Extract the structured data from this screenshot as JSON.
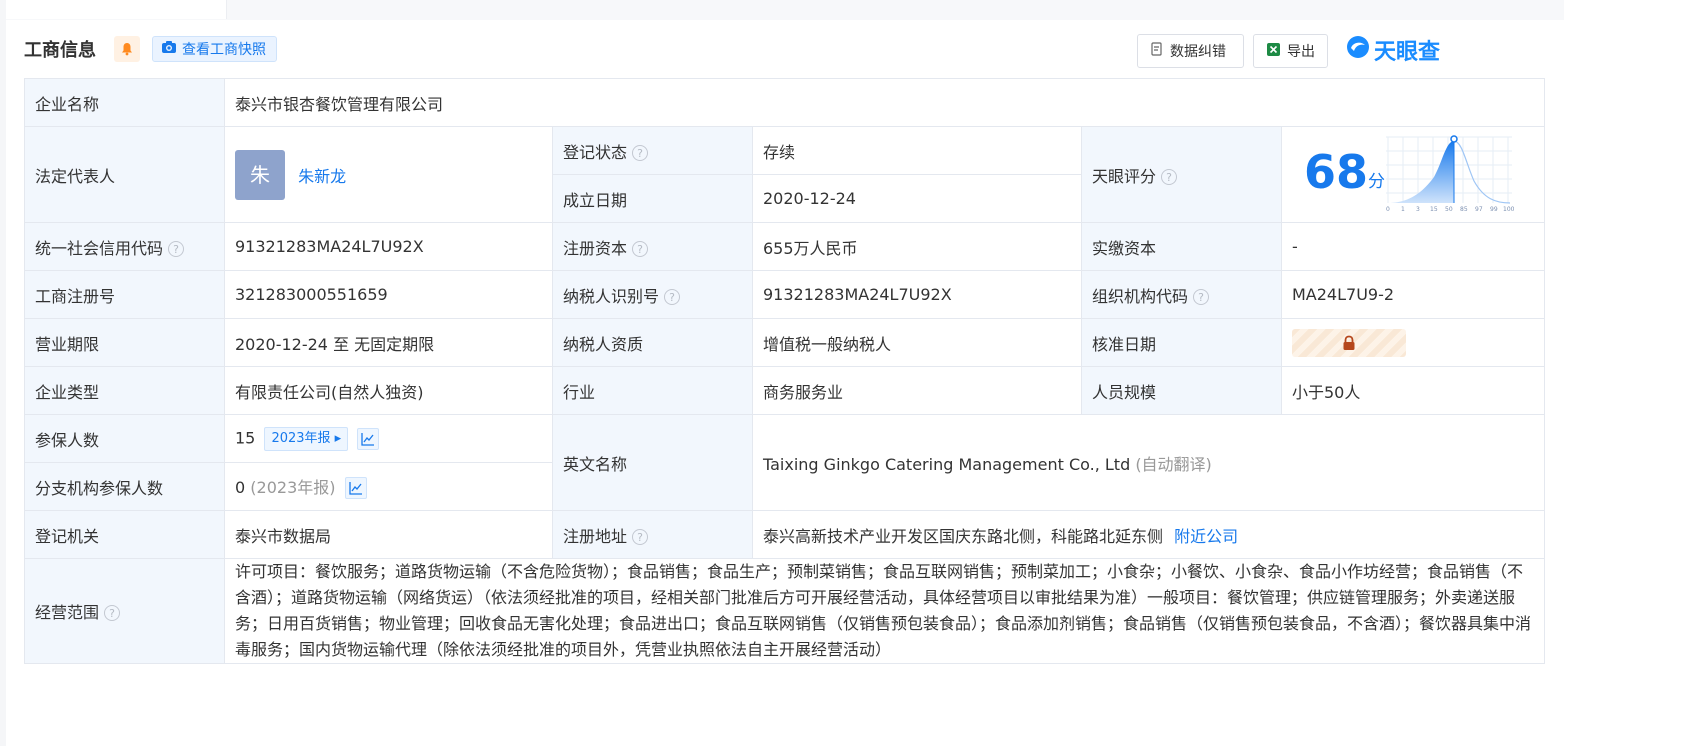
{
  "header": {
    "title": "工商信息",
    "snapshot_label": "查看工商快照",
    "error_label": "数据纠错",
    "export_label": "导出",
    "brand": "天眼查"
  },
  "rows": {
    "company_name_label": "企业名称",
    "company_name": "泰兴市银杏餐饮管理有限公司",
    "legal_rep_label": "法定代表人",
    "legal_rep_avatar": "朱",
    "legal_rep_name": "朱新龙",
    "reg_status_label": "登记状态",
    "reg_status": "存续",
    "found_date_label": "成立日期",
    "found_date": "2020-12-24",
    "tianyan_score_label": "天眼评分",
    "score": "68",
    "score_unit": "分",
    "score_axis": [
      "0",
      "1",
      "3",
      "15",
      "50",
      "85",
      "97",
      "99",
      "100"
    ],
    "credit_code_label": "统一社会信用代码",
    "credit_code": "91321283MA24L7U92X",
    "reg_capital_label": "注册资本",
    "reg_capital": "655万人民币",
    "paid_capital_label": "实缴资本",
    "paid_capital": "-",
    "biz_reg_no_label": "工商注册号",
    "biz_reg_no": "321283000551659",
    "taxpayer_id_label": "纳税人识别号",
    "taxpayer_id": "91321283MA24L7U92X",
    "org_code_label": "组织机构代码",
    "org_code": "MA24L7U9-2",
    "term_label": "营业期限",
    "term": "2020-12-24 至 无固定期限",
    "taxpayer_qual_label": "纳税人资质",
    "taxpayer_qual": "增值税一般纳税人",
    "approve_date_label": "核准日期",
    "type_label": "企业类型",
    "type": "有限责任公司(自然人独资)",
    "industry_label": "行业",
    "industry": "商务服务业",
    "staff_size_label": "人员规模",
    "staff_size": "小于50人",
    "insured_label": "参保人数",
    "insured": "15",
    "insured_year_btn": "2023年报",
    "english_name_label": "英文名称",
    "english_name": "Taixing Ginkgo Catering Management Co., Ltd",
    "english_name_note": "(自动翻译)",
    "branch_insured_label": "分支机构参保人数",
    "branch_insured": "0",
    "branch_insured_year": "(2023年报)",
    "authority_label": "登记机关",
    "authority": "泰兴市数据局",
    "address_label": "注册地址",
    "address": "泰兴高新技术产业开发区国庆东路北侧，科能路北延东侧",
    "nearby_link": "附近公司",
    "scope_label": "经营范围",
    "scope": "许可项目：餐饮服务；道路货物运输（不含危险货物）；食品销售；食品生产；预制菜销售；食品互联网销售；预制菜加工；小食杂；小餐饮、小食杂、食品小作坊经营；食品销售（不含酒）；道路货物运输（网络货运）（依法须经批准的项目，经相关部门批准后方可开展经营活动，具体经营项目以审批结果为准）一般项目：餐饮管理；供应链管理服务；外卖递送服务；日用百货销售；物业管理；回收食品无害化处理；食品进出口；食品互联网销售（仅销售预包装食品）；食品添加剂销售；食品销售（仅销售预包装食品，不含酒）；餐饮器具集中消毒服务；国内货物运输代理（除依法须经批准的项目外，凭营业执照依法自主开展经营活动）"
  },
  "colors": {
    "accent": "#1779ec",
    "label_bg": "#f2f7fd",
    "status_green": "#1aa35a"
  }
}
